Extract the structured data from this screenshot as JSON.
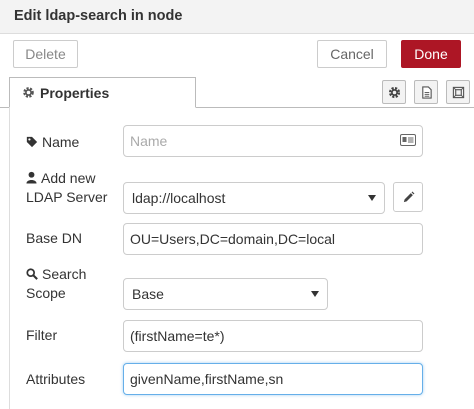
{
  "window": {
    "title": "Edit ldap-search in node"
  },
  "toolbar": {
    "delete_label": "Delete",
    "cancel_label": "Cancel",
    "done_label": "Done"
  },
  "tabs": [
    {
      "label": "Properties",
      "icon": "gear-icon"
    }
  ],
  "tool_buttons": [
    "settings-icon",
    "description-icon",
    "appearance-icon"
  ],
  "form": {
    "name": {
      "label": "Name",
      "icon": "tag-icon",
      "placeholder": "Name",
      "value": ""
    },
    "server": {
      "label_line1": "Add new",
      "label_line2": "LDAP Server",
      "icon": "user-icon",
      "value": "ldap://localhost"
    },
    "base_dn": {
      "label": "Base DN",
      "value": "OU=Users,DC=domain,DC=local"
    },
    "scope": {
      "label_line1": "Search",
      "label_line2": "Scope",
      "icon": "search-icon",
      "value": "Base"
    },
    "filter": {
      "label": "Filter",
      "value": "(firstName=te*)"
    },
    "attributes": {
      "label": "Attributes",
      "value": "givenName,firstName,sn"
    }
  },
  "colors": {
    "done": "#ad1625",
    "focus": "#66afe9"
  }
}
